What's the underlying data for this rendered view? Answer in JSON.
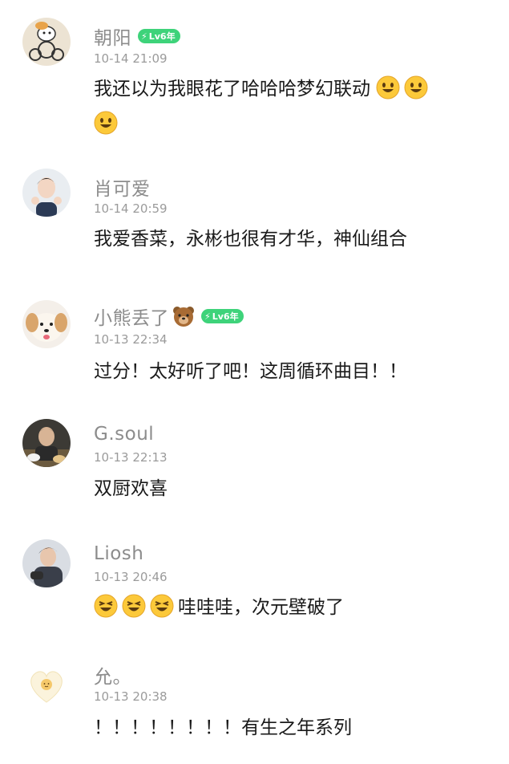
{
  "comments": [
    {
      "username": "朝阳",
      "level_badge": "Lv6年",
      "timestamp": "10-14 21:09",
      "text_line1": "我还以为我眼花了哈哈哈梦幻联动",
      "text_trailing_emoji": "smiley-emoji",
      "text_emoji_count": 3
    },
    {
      "username": "肖可爱",
      "timestamp": "10-14 20:59",
      "text": "我爱香菜，永彬也很有才华，神仙组合"
    },
    {
      "username": "小熊丢了",
      "username_emoji": "bear-face-emoji",
      "level_badge": "Lv6年",
      "timestamp": "10-13 22:34",
      "text": "过分！太好听了吧！这周循环曲目！！"
    },
    {
      "username": "G.soul",
      "timestamp": "10-13 22:13",
      "text": "双厨欢喜"
    },
    {
      "username": "Liosh",
      "timestamp": "10-13 20:46",
      "text_leading_emoji": "laughing-emoji",
      "text_emoji_count": 3,
      "text": "哇哇哇，次元壁破了"
    },
    {
      "username": "允。",
      "timestamp": "10-13 20:38",
      "text": "！！！！！！！！有生之年系列"
    }
  ],
  "colors": {
    "username": "#8c8c8c",
    "timestamp": "#9b9b9b",
    "text": "#1a1a1a",
    "badge": "#3ed37a"
  }
}
